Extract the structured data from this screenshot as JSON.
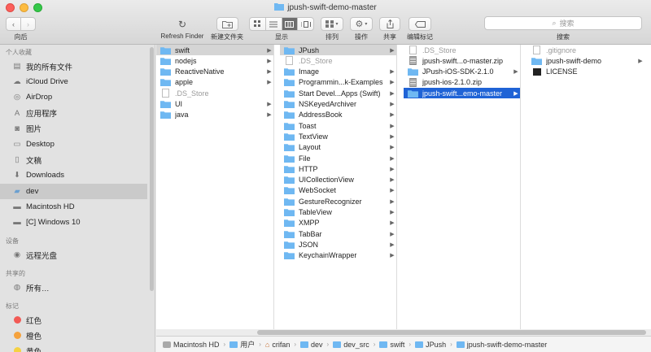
{
  "window": {
    "title": "jpush-swift-demo-master"
  },
  "toolbar": {
    "back_label": "向后",
    "refresh_label": "Refresh Finder",
    "new_folder_label": "新建文件夹",
    "view_label": "显示",
    "arrange_label": "排列",
    "action_label": "操作",
    "share_label": "共享",
    "tags_label": "编辑标记",
    "search_label": "搜索",
    "search_placeholder": "搜索"
  },
  "sidebar": {
    "favorites_header": "个人收藏",
    "favorites": [
      {
        "label": "我的所有文件",
        "icon": "all-files-icon"
      },
      {
        "label": "iCloud Drive",
        "icon": "cloud-icon"
      },
      {
        "label": "AirDrop",
        "icon": "airdrop-icon"
      },
      {
        "label": "应用程序",
        "icon": "applications-icon"
      },
      {
        "label": "图片",
        "icon": "camera-icon"
      },
      {
        "label": "Desktop",
        "icon": "desktop-icon"
      },
      {
        "label": "文稿",
        "icon": "documents-icon"
      },
      {
        "label": "Downloads",
        "icon": "downloads-icon"
      },
      {
        "label": "dev",
        "icon": "folder-icon"
      },
      {
        "label": "Macintosh HD",
        "icon": "hard-disk-icon"
      },
      {
        "label": "[C] Windows 10",
        "icon": "hard-disk-icon"
      }
    ],
    "devices_header": "设备",
    "devices": [
      {
        "label": "远程光盘",
        "icon": "optical-disc-icon"
      }
    ],
    "shared_header": "共享的",
    "shared": [
      {
        "label": "所有…",
        "icon": "network-icon"
      }
    ],
    "tags_header": "标记",
    "tags": [
      {
        "label": "红色",
        "color": "#f25a55"
      },
      {
        "label": "橙色",
        "color": "#f5a23d"
      },
      {
        "label": "黄色",
        "color": "#f5d142"
      }
    ]
  },
  "columns": [
    {
      "items": [
        {
          "name": "swift",
          "kind": "folder",
          "arrow": true,
          "state": "grey"
        },
        {
          "name": "nodejs",
          "kind": "folder",
          "arrow": true
        },
        {
          "name": "ReactiveNative",
          "kind": "folder",
          "arrow": true
        },
        {
          "name": "apple",
          "kind": "folder",
          "arrow": true
        },
        {
          "name": ".DS_Store",
          "kind": "doc",
          "arrow": false,
          "dim": true
        },
        {
          "name": "UI",
          "kind": "folder",
          "arrow": true
        },
        {
          "name": "java",
          "kind": "folder",
          "arrow": true
        }
      ]
    },
    {
      "items": [
        {
          "name": "JPush",
          "kind": "folder",
          "arrow": true,
          "state": "grey"
        },
        {
          "name": ".DS_Store",
          "kind": "doc",
          "arrow": false,
          "dim": true
        },
        {
          "name": "Image",
          "kind": "folder",
          "arrow": true
        },
        {
          "name": "Programmin...k-Examples",
          "kind": "folder",
          "arrow": true
        },
        {
          "name": "Start Devel...Apps (Swift)",
          "kind": "folder",
          "arrow": true
        },
        {
          "name": "NSKeyedArchiver",
          "kind": "folder",
          "arrow": true
        },
        {
          "name": "AddressBook",
          "kind": "folder",
          "arrow": true
        },
        {
          "name": "Toast",
          "kind": "folder",
          "arrow": true
        },
        {
          "name": "TextView",
          "kind": "folder",
          "arrow": true
        },
        {
          "name": "Layout",
          "kind": "folder",
          "arrow": true
        },
        {
          "name": "File",
          "kind": "folder",
          "arrow": true
        },
        {
          "name": "HTTP",
          "kind": "folder",
          "arrow": true
        },
        {
          "name": "UICollectionView",
          "kind": "folder",
          "arrow": true
        },
        {
          "name": "WebSocket",
          "kind": "folder",
          "arrow": true
        },
        {
          "name": "GestureRecognizer",
          "kind": "folder",
          "arrow": true
        },
        {
          "name": "TableView",
          "kind": "folder",
          "arrow": true
        },
        {
          "name": "XMPP",
          "kind": "folder",
          "arrow": true
        },
        {
          "name": "TabBar",
          "kind": "folder",
          "arrow": true
        },
        {
          "name": "JSON",
          "kind": "folder",
          "arrow": true
        },
        {
          "name": "KeychainWrapper",
          "kind": "folder",
          "arrow": true
        }
      ]
    },
    {
      "items": [
        {
          "name": ".DS_Store",
          "kind": "doc",
          "arrow": false,
          "dim": true
        },
        {
          "name": "jpush-swift...o-master.zip",
          "kind": "zip",
          "arrow": false
        },
        {
          "name": "JPush-iOS-SDK-2.1.0",
          "kind": "folder",
          "arrow": true
        },
        {
          "name": "jpush-ios-2.1.0.zip",
          "kind": "zip",
          "arrow": false
        },
        {
          "name": "jpush-swift...emo-master",
          "kind": "folder",
          "arrow": true,
          "state": "blue"
        }
      ]
    },
    {
      "items": [
        {
          "name": ".gitignore",
          "kind": "doc",
          "arrow": false,
          "dim": true
        },
        {
          "name": "jpush-swift-demo",
          "kind": "folder",
          "arrow": true
        },
        {
          "name": "LICENSE",
          "kind": "license",
          "arrow": false
        }
      ]
    }
  ],
  "pathbar": [
    {
      "label": "Macintosh HD",
      "icon": "hard-disk-icon"
    },
    {
      "label": "用户",
      "icon": "folder-icon"
    },
    {
      "label": "crifan",
      "icon": "home-icon"
    },
    {
      "label": "dev",
      "icon": "folder-icon"
    },
    {
      "label": "dev_src",
      "icon": "folder-icon"
    },
    {
      "label": "swift",
      "icon": "folder-icon"
    },
    {
      "label": "JPush",
      "icon": "folder-icon"
    },
    {
      "label": "jpush-swift-demo-master",
      "icon": "folder-icon"
    }
  ],
  "colors": {
    "selection_blue": "#1f63d6",
    "folder_blue": "#6fb8f2"
  }
}
